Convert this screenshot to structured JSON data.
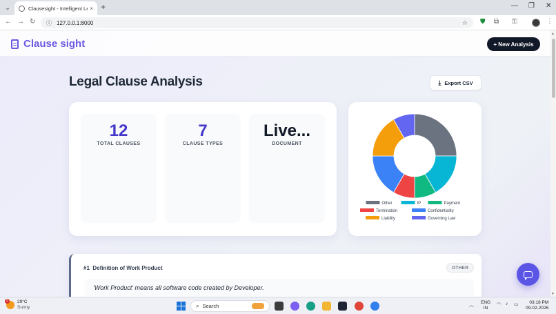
{
  "browser": {
    "tab_title": "Clausesight - Intelligent Legal R",
    "url": "127.0.0.1:8000",
    "new_tab": "+",
    "tab_close": "×",
    "minimize": "—",
    "maximize": "❐",
    "close": "✕"
  },
  "app": {
    "logo_text": "Clause sight",
    "new_analysis_label": "+ New Analysis",
    "page_title": "Legal Clause Analysis",
    "export_label": "Export CSV"
  },
  "stats": [
    {
      "value": "12",
      "label": "TOTAL CLAUSES",
      "color": "#4338ca"
    },
    {
      "value": "7",
      "label": "CLAUSE TYPES",
      "color": "#4338ca"
    },
    {
      "value": "Live...",
      "label": "DOCUMENT",
      "color": "#111827"
    }
  ],
  "chart_data": {
    "type": "pie",
    "donut": true,
    "title": "",
    "categories": [
      "Other",
      "IP",
      "Payment",
      "Termination",
      "Confidentiality",
      "Liability",
      "Governing Law"
    ],
    "values": [
      3,
      2,
      1,
      1,
      2,
      2,
      1
    ],
    "colors": [
      "#6b7280",
      "#06b6d4",
      "#10b981",
      "#ef4444",
      "#3b82f6",
      "#f59e0b",
      "#6366f1"
    ],
    "legend_position": "bottom"
  },
  "clause": {
    "number": "#1",
    "title": "Definition of Work Product",
    "badge": "OTHER",
    "text": "'Work Product' means all software code created by Developer."
  },
  "taskbar": {
    "weather_badge": "5",
    "temperature": "29°C",
    "condition": "Sunny",
    "search_label": "Search",
    "lang_line1": "ENG",
    "lang_line2": "IN",
    "time": "03:18 PM",
    "date": "09-02-2026"
  }
}
